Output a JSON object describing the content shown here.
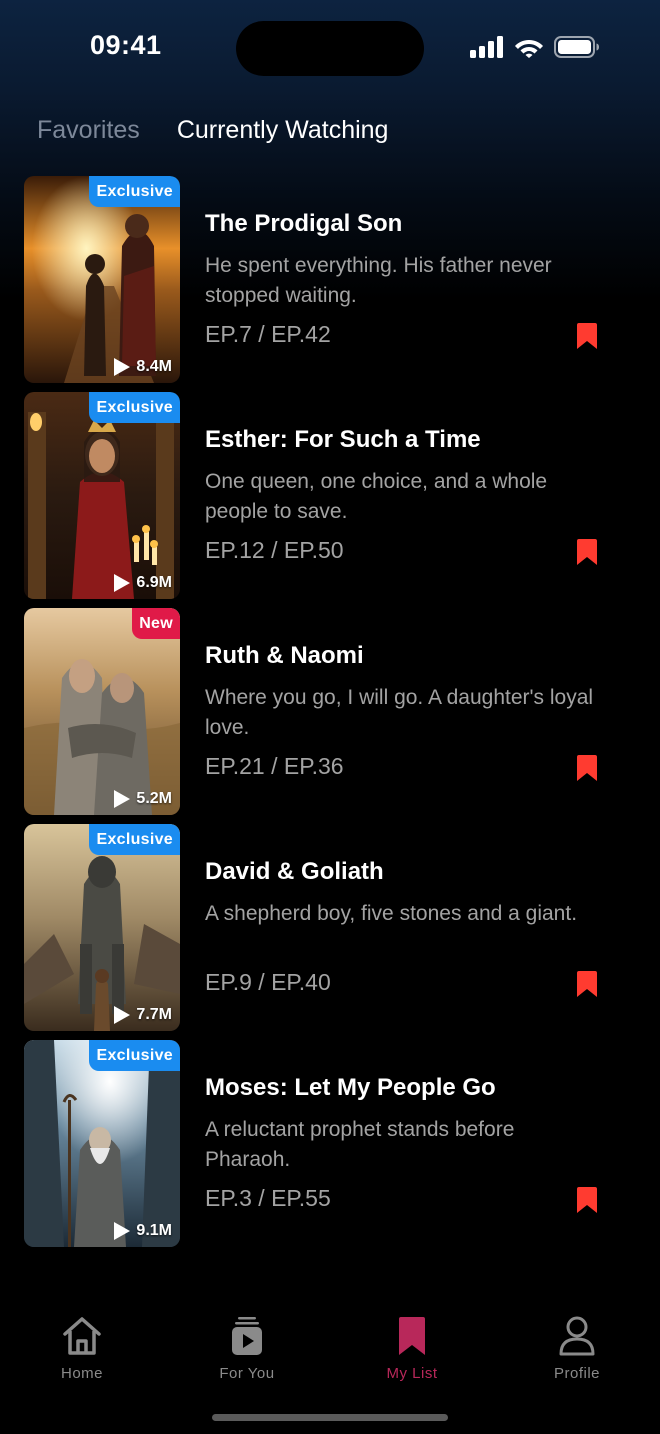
{
  "status_bar": {
    "time": "09:41"
  },
  "tabs": [
    {
      "label": "Favorites",
      "active": false
    },
    {
      "label": "Currently Watching",
      "active": true
    }
  ],
  "items": [
    {
      "title": "The Prodigal Son",
      "description": "He spent everything. His father never stopped waiting.",
      "episode": "EP.7 / EP.42",
      "badge": "Exclusive",
      "views": "8.4M"
    },
    {
      "title": "Esther: For Such a Time",
      "description": "One queen, one choice, and a whole people to save.",
      "episode": "EP.12 / EP.50",
      "badge": "Exclusive",
      "views": "6.9M"
    },
    {
      "title": "Ruth & Naomi",
      "description": "Where you go, I will go. A daughter's loyal love.",
      "episode": "EP.21 / EP.36",
      "badge": "New",
      "views": "5.2M"
    },
    {
      "title": "David & Goliath",
      "description": "A shepherd boy, five stones and a giant.",
      "episode": "EP.9 / EP.40",
      "badge": "Exclusive",
      "views": "7.7M"
    },
    {
      "title": "Moses: Let My People Go",
      "description": "A reluctant prophet stands before Pharaoh.",
      "episode": "EP.3 / EP.55",
      "badge": "Exclusive",
      "views": "9.1M"
    }
  ],
  "bottom_nav": [
    {
      "label": "Home",
      "icon": "home-icon",
      "active": false
    },
    {
      "label": "For You",
      "icon": "play-stack-icon",
      "active": false
    },
    {
      "label": "My List",
      "icon": "bookmark-icon",
      "active": true
    },
    {
      "label": "Profile",
      "icon": "person-icon",
      "active": false
    }
  ],
  "colors": {
    "accent_bookmark": "#ff3b30",
    "active_nav": "#b8285a",
    "badge_exclusive": "#1a8cf0",
    "badge_new": "#e01a48"
  }
}
